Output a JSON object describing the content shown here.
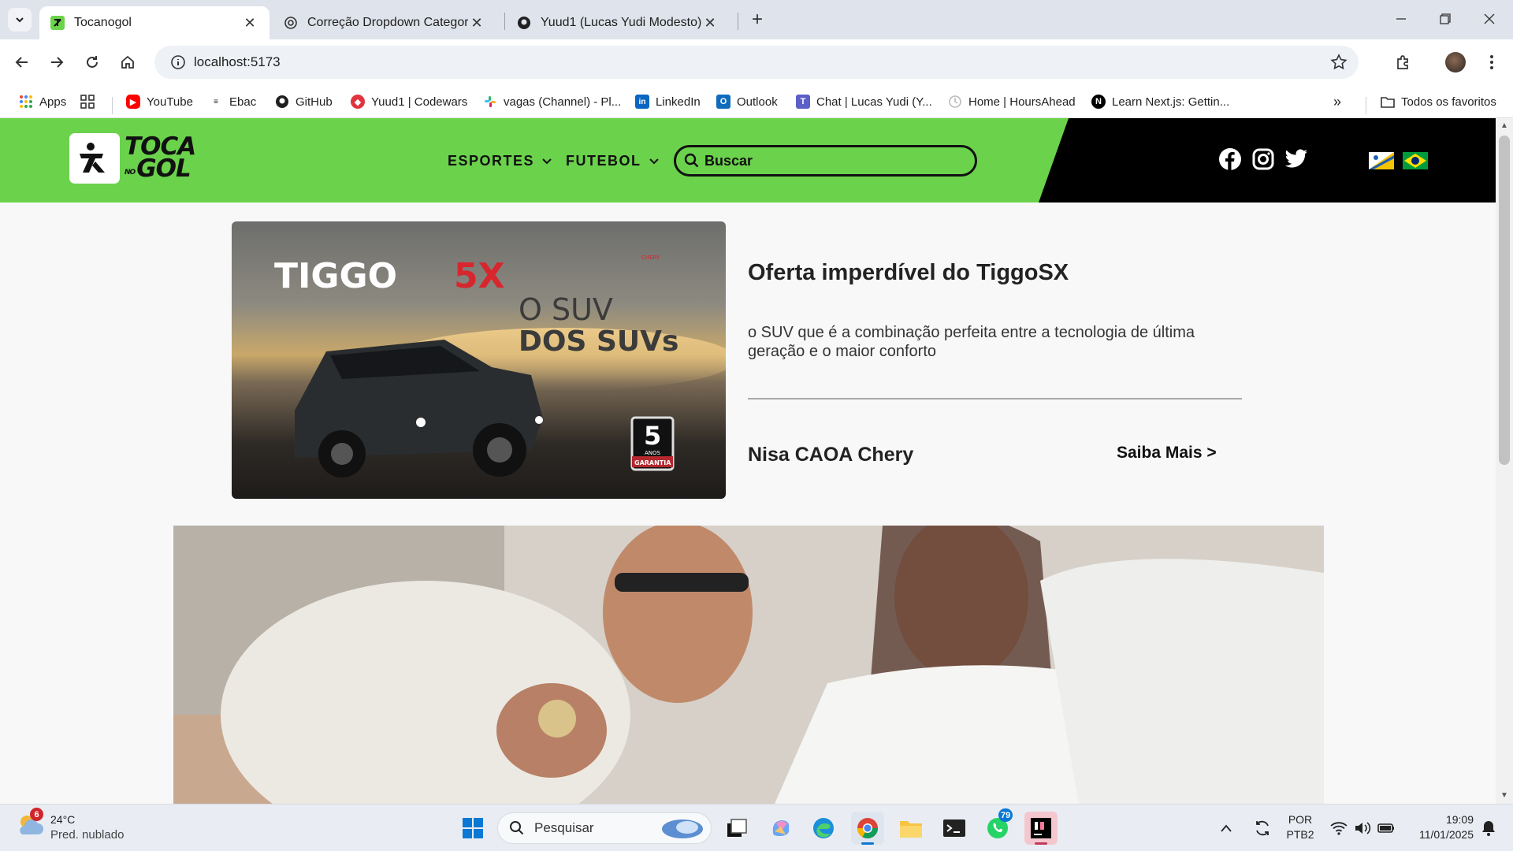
{
  "browser": {
    "tabs": [
      {
        "title": "Tocanogol",
        "active": true
      },
      {
        "title": "Correção Dropdown Categoria",
        "active": false
      },
      {
        "title": "Yuud1 (Lucas Yudi Modesto)",
        "active": false
      }
    ],
    "url": "localhost:5173",
    "bookmarks": [
      {
        "label": "Apps",
        "icon": "apps-grid-icon"
      },
      {
        "label": "YouTube",
        "icon": "youtube-icon"
      },
      {
        "label": "Ebac",
        "icon": "ebac-icon"
      },
      {
        "label": "GitHub",
        "icon": "github-icon"
      },
      {
        "label": "Yuud1 | Codewars",
        "icon": "codewars-icon"
      },
      {
        "label": "vagas (Channel) - Pl...",
        "icon": "slack-icon"
      },
      {
        "label": "LinkedIn",
        "icon": "linkedin-icon"
      },
      {
        "label": "Outlook",
        "icon": "outlook-icon"
      },
      {
        "label": "Chat | Lucas Yudi (Y...",
        "icon": "teams-icon"
      },
      {
        "label": "Home | HoursAhead",
        "icon": "hoursahead-icon"
      },
      {
        "label": "Learn Next.js: Gettin...",
        "icon": "nextjs-icon"
      }
    ],
    "all_bookmarks_label": "Todos os favoritos"
  },
  "site": {
    "logo_top": "TOCA",
    "logo_no": "NO",
    "logo_bottom": "GOL",
    "menu": [
      {
        "label": "ESPORTES"
      },
      {
        "label": "FUTEBOL"
      }
    ],
    "search_placeholder": "Buscar",
    "colors": {
      "header_green": "#6bd24c",
      "header_black": "#000000"
    }
  },
  "ad": {
    "image_text_brand": "TIGGO",
    "image_text_model": "5X",
    "image_text_slogan_1": "O SUV",
    "image_text_slogan_2": "DOS SUVs",
    "image_badge_number": "5",
    "image_badge_text_1": "ANOS",
    "image_badge_text_2": "GARANTIA",
    "image_logo_text": "CHERY",
    "title": "Oferta imperdível do TiggoSX",
    "description": "o SUV que é a combinação perfeita entre a tecnologia de última geração e o maior conforto",
    "brand": "Nisa CAOA Chery",
    "more_link": "Saiba Mais >"
  },
  "taskbar": {
    "weather_badge": "6",
    "temperature": "24°C",
    "weather_desc": "Pred. nublado",
    "search_placeholder": "Pesquisar",
    "whatsapp_badge": "79",
    "language_1": "POR",
    "language_2": "PTB2",
    "time": "19:09",
    "date": "11/01/2025"
  }
}
